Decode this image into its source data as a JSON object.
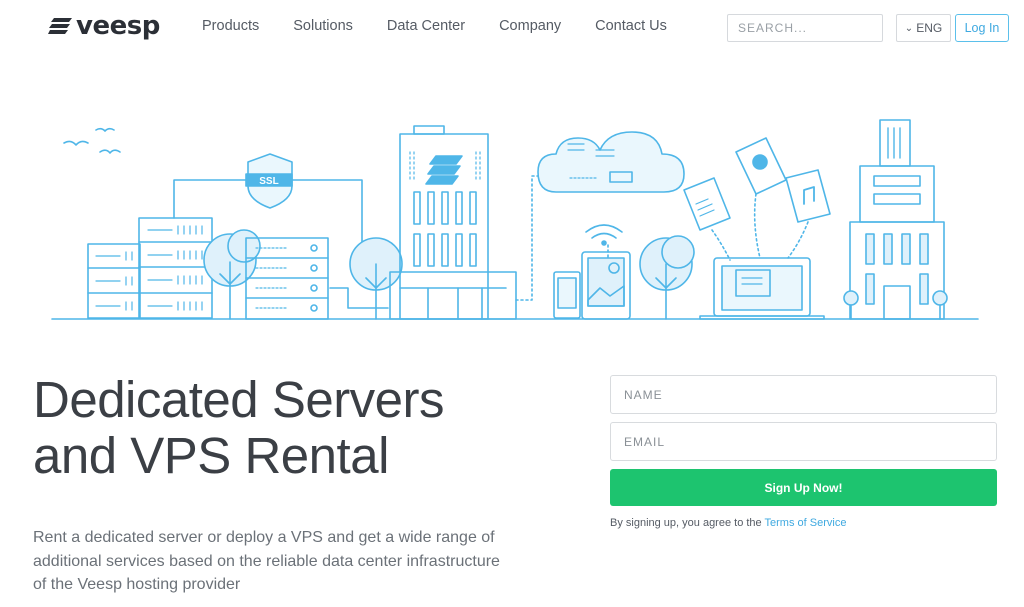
{
  "header": {
    "logo_text": "veesp",
    "nav": [
      {
        "label": "Products"
      },
      {
        "label": "Solutions"
      },
      {
        "label": "Data Center"
      },
      {
        "label": "Company"
      },
      {
        "label": "Contact Us"
      }
    ],
    "search_placeholder": "SEARCH...",
    "language": "ENG",
    "login_label": "Log In"
  },
  "illustration": {
    "ssl_label": "SSL",
    "icons": [
      "bird-icon",
      "server-rack-icon",
      "ssl-shield-icon",
      "tree-icon",
      "data-center-building-icon",
      "cloud-icon",
      "tablet-icon",
      "wifi-icon",
      "document-icon",
      "video-file-icon",
      "music-file-icon",
      "laptop-icon",
      "office-tower-icon"
    ]
  },
  "hero": {
    "headline_line1": "Dedicated Servers",
    "headline_line2": "and VPS Rental",
    "subtext": "Rent a dedicated server or deploy a VPS and get a wide range of additional services based on the reliable data center infrastructure of the Veesp hosting provider"
  },
  "form": {
    "name_placeholder": "NAME",
    "email_placeholder": "EMAIL",
    "signup_label": "Sign Up Now!",
    "terms_prefix": "By signing up, you agree to the",
    "terms_link": "Terms of Service"
  },
  "colors": {
    "accent_blue": "#5bc0eb",
    "signup_green": "#1dc46f",
    "text_dark": "#3b3f45"
  }
}
